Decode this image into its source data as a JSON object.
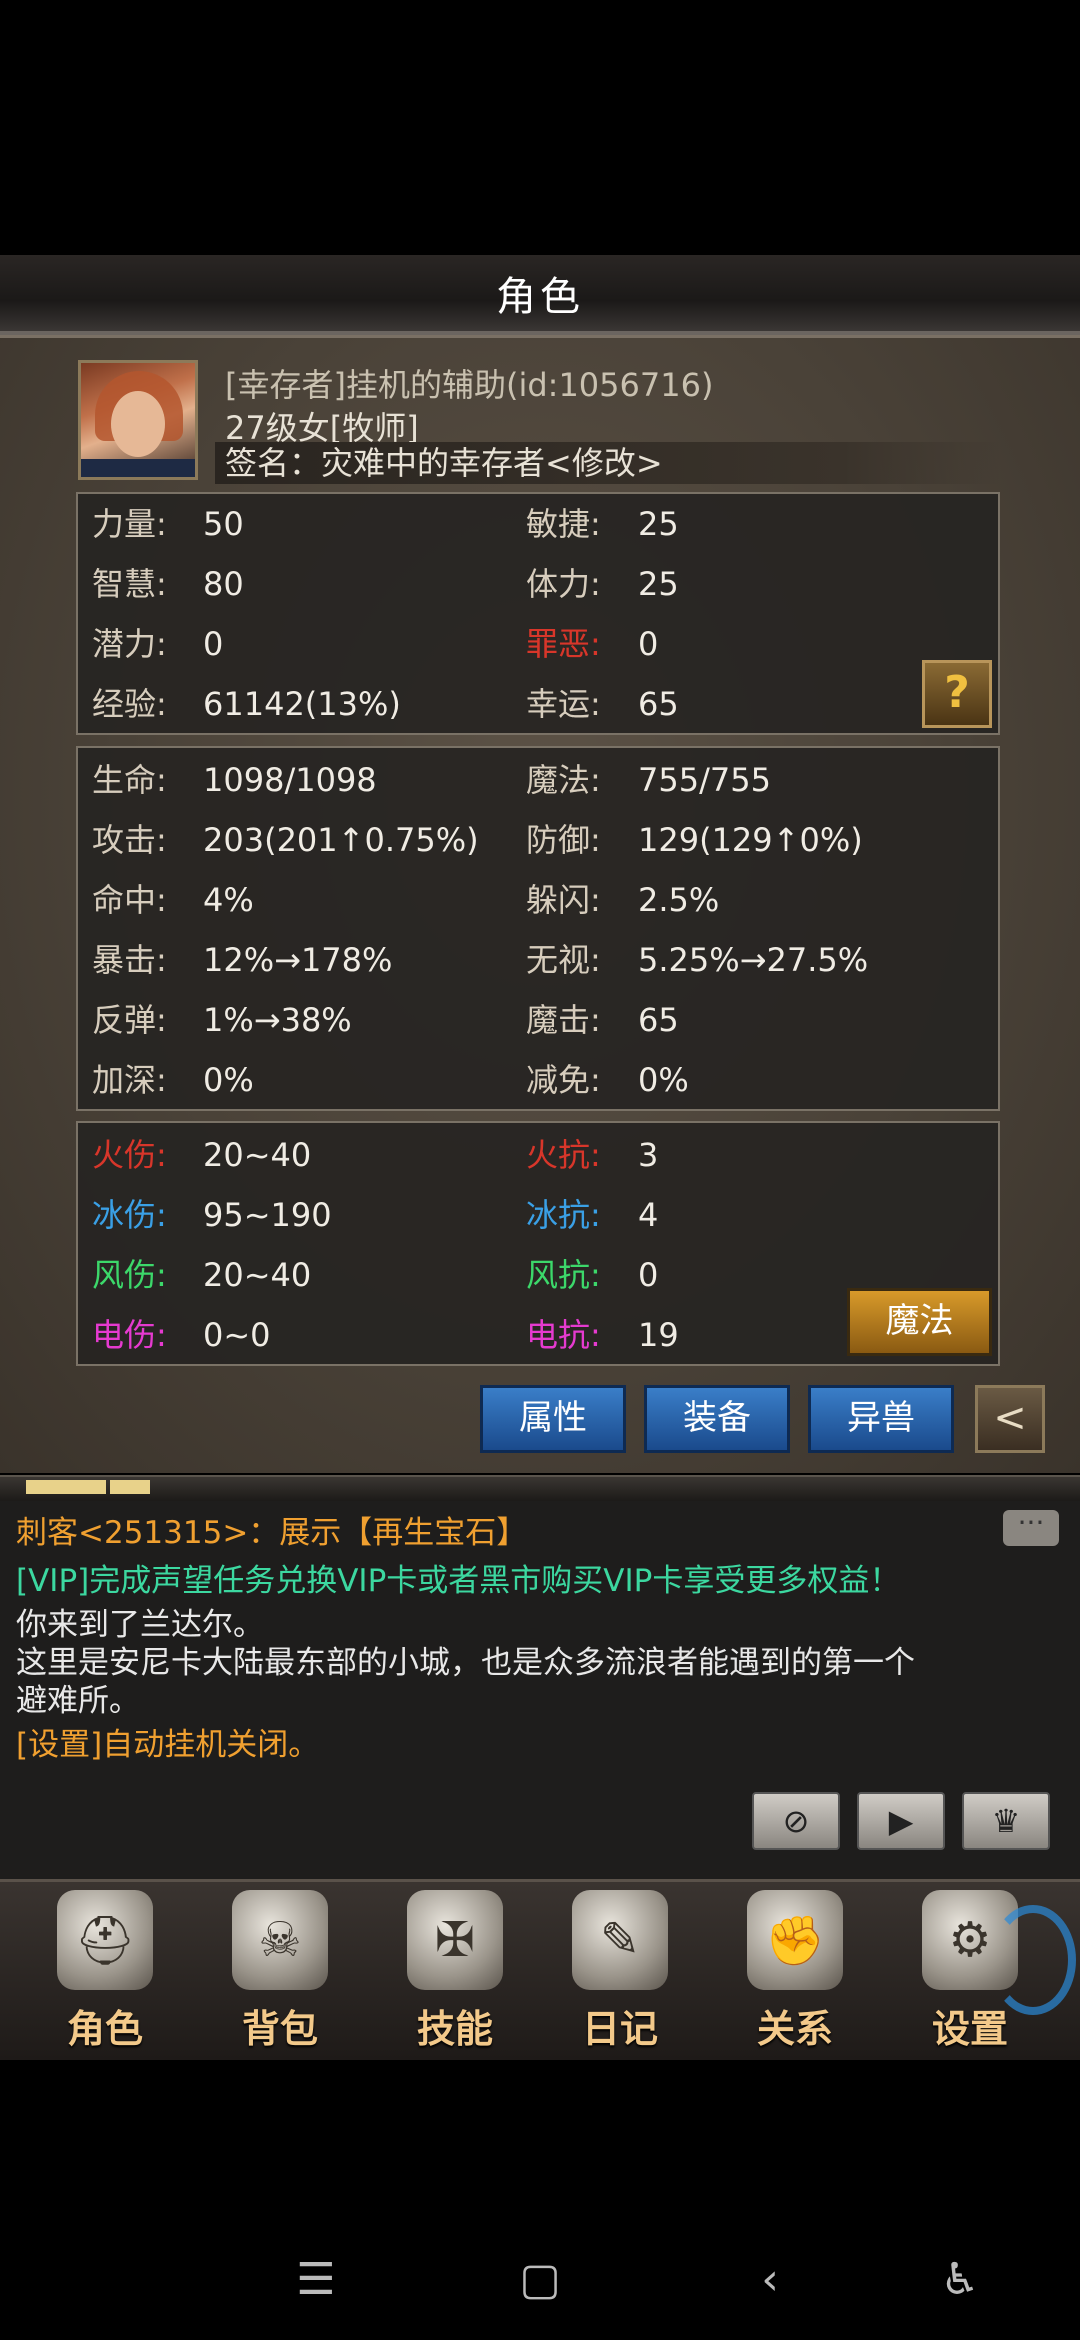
{
  "header": {
    "title": "角色"
  },
  "profile": {
    "name": "[幸存者]挂机的辅助(id:1056716)",
    "level": "27级女[牧师]",
    "signature": "签名：灾难中的幸存者<修改>"
  },
  "base_stats": [
    {
      "l1": "力量:",
      "v1": "50",
      "l2": "敏捷:",
      "v2": "25"
    },
    {
      "l1": "智慧:",
      "v1": "80",
      "l2": "体力:",
      "v2": "25"
    },
    {
      "l1": "潜力:",
      "v1": "0",
      "l2": "罪恶:",
      "v2": "0"
    },
    {
      "l1": "经验:",
      "v1": "61142(13%)",
      "l2": "幸运:",
      "v2": "65"
    }
  ],
  "combat_stats": [
    {
      "l1": "生命:",
      "v1": "1098/1098",
      "l2": "魔法:",
      "v2": "755/755"
    },
    {
      "l1": "攻击:",
      "v1": "203(201↑0.75%)",
      "l2": "防御:",
      "v2": "129(129↑0%)"
    },
    {
      "l1": "命中:",
      "v1": "4%",
      "l2": "躲闪:",
      "v2": "2.5%"
    },
    {
      "l1": "暴击:",
      "v1": "12%→178%",
      "l2": "无视:",
      "v2": "5.25%→27.5%"
    },
    {
      "l1": "反弹:",
      "v1": "1%→38%",
      "l2": "魔击:",
      "v2": "65"
    },
    {
      "l1": "加深:",
      "v1": "0%",
      "l2": "减免:",
      "v2": "0%"
    }
  ],
  "element_stats": [
    {
      "l1": "火伤:",
      "v1": "20~40",
      "l2": "火抗:",
      "v2": "3"
    },
    {
      "l1": "冰伤:",
      "v1": "95~190",
      "l2": "冰抗:",
      "v2": "4"
    },
    {
      "l1": "风伤:",
      "v1": "20~40",
      "l2": "风抗:",
      "v2": "0"
    },
    {
      "l1": "电伤:",
      "v1": "0~0",
      "l2": "电抗:",
      "v2": "19"
    }
  ],
  "buttons": {
    "help": "?",
    "magic": "魔法",
    "attributes": "属性",
    "equipment": "装备",
    "beast": "异兽",
    "back": "<"
  },
  "chat": {
    "lines": [
      "刺客<251315>：展示【再生宝石】",
      "[VIP]完成声望任务兑换VIP卡或者黑市购买VIP卡享受更多权益！",
      "你来到了兰达尔。",
      "这里是安尼卡大陆最东部的小城，也是众多流浪者能遇到的第一个",
      "避难所。",
      "[设置]自动挂机关闭。"
    ]
  },
  "bottom_nav": [
    {
      "label": "角色",
      "icon": "helmet-icon"
    },
    {
      "label": "背包",
      "icon": "backpack-icon"
    },
    {
      "label": "技能",
      "icon": "skill-book-icon"
    },
    {
      "label": "日记",
      "icon": "scroll-icon"
    },
    {
      "label": "关系",
      "icon": "gauntlets-icon"
    },
    {
      "label": "设置",
      "icon": "gear-icon"
    }
  ],
  "colors": {
    "fire": "#d8362a",
    "ice": "#3aa0e6",
    "wind": "#3cd86a",
    "electric": "#e63ad0",
    "chat_orange": "#f0a030",
    "chat_green": "#3cd8a0",
    "chat_white": "#e8e8e8"
  }
}
